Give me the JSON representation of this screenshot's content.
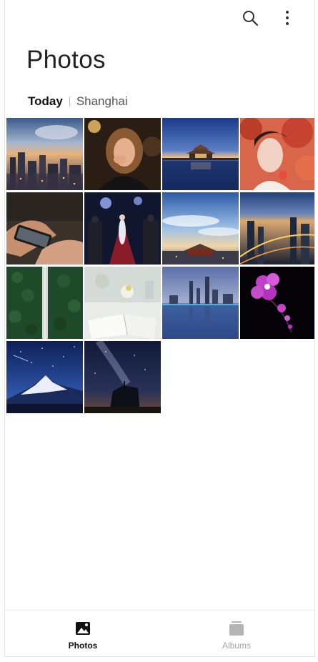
{
  "header": {
    "title": "Photos",
    "search_icon": "search-icon",
    "more_icon": "more-vertical-icon"
  },
  "section": {
    "date": "Today",
    "location": "Shanghai"
  },
  "photos": [
    {
      "subject": "city skyline at dusk"
    },
    {
      "subject": "woman portrait warm light"
    },
    {
      "subject": "pagoda at twilight over water"
    },
    {
      "subject": "woman with red autumn leaves"
    },
    {
      "subject": "hands holding smartphone"
    },
    {
      "subject": "red carpet with photographers"
    },
    {
      "subject": "forbidden city under clouds"
    },
    {
      "subject": "city aerial at night"
    },
    {
      "subject": "road through green forest"
    },
    {
      "subject": "notebook on white desk"
    },
    {
      "subject": "city skyline reflection"
    },
    {
      "subject": "purple orchid on black"
    },
    {
      "subject": "snow mountain under starry sky"
    },
    {
      "subject": "milky way over rocks"
    }
  ],
  "tabbar": {
    "tabs": [
      {
        "label": "Photos",
        "icon": "image-icon",
        "active": true
      },
      {
        "label": "Albums",
        "icon": "albums-icon",
        "active": false
      }
    ]
  },
  "colors": {
    "active": "#111111",
    "inactive": "#a5a5a5"
  }
}
